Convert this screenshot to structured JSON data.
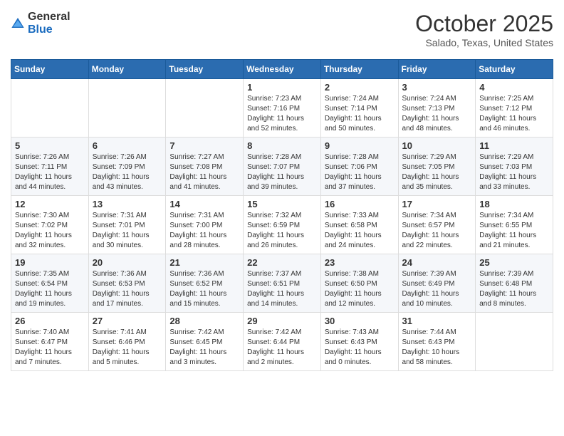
{
  "header": {
    "logo_general": "General",
    "logo_blue": "Blue",
    "month_title": "October 2025",
    "location": "Salado, Texas, United States"
  },
  "weekdays": [
    "Sunday",
    "Monday",
    "Tuesday",
    "Wednesday",
    "Thursday",
    "Friday",
    "Saturday"
  ],
  "weeks": [
    [
      {
        "day": "",
        "sunrise": "",
        "sunset": "",
        "daylight": ""
      },
      {
        "day": "",
        "sunrise": "",
        "sunset": "",
        "daylight": ""
      },
      {
        "day": "",
        "sunrise": "",
        "sunset": "",
        "daylight": ""
      },
      {
        "day": "1",
        "sunrise": "Sunrise: 7:23 AM",
        "sunset": "Sunset: 7:16 PM",
        "daylight": "Daylight: 11 hours and 52 minutes."
      },
      {
        "day": "2",
        "sunrise": "Sunrise: 7:24 AM",
        "sunset": "Sunset: 7:14 PM",
        "daylight": "Daylight: 11 hours and 50 minutes."
      },
      {
        "day": "3",
        "sunrise": "Sunrise: 7:24 AM",
        "sunset": "Sunset: 7:13 PM",
        "daylight": "Daylight: 11 hours and 48 minutes."
      },
      {
        "day": "4",
        "sunrise": "Sunrise: 7:25 AM",
        "sunset": "Sunset: 7:12 PM",
        "daylight": "Daylight: 11 hours and 46 minutes."
      }
    ],
    [
      {
        "day": "5",
        "sunrise": "Sunrise: 7:26 AM",
        "sunset": "Sunset: 7:11 PM",
        "daylight": "Daylight: 11 hours and 44 minutes."
      },
      {
        "day": "6",
        "sunrise": "Sunrise: 7:26 AM",
        "sunset": "Sunset: 7:09 PM",
        "daylight": "Daylight: 11 hours and 43 minutes."
      },
      {
        "day": "7",
        "sunrise": "Sunrise: 7:27 AM",
        "sunset": "Sunset: 7:08 PM",
        "daylight": "Daylight: 11 hours and 41 minutes."
      },
      {
        "day": "8",
        "sunrise": "Sunrise: 7:28 AM",
        "sunset": "Sunset: 7:07 PM",
        "daylight": "Daylight: 11 hours and 39 minutes."
      },
      {
        "day": "9",
        "sunrise": "Sunrise: 7:28 AM",
        "sunset": "Sunset: 7:06 PM",
        "daylight": "Daylight: 11 hours and 37 minutes."
      },
      {
        "day": "10",
        "sunrise": "Sunrise: 7:29 AM",
        "sunset": "Sunset: 7:05 PM",
        "daylight": "Daylight: 11 hours and 35 minutes."
      },
      {
        "day": "11",
        "sunrise": "Sunrise: 7:29 AM",
        "sunset": "Sunset: 7:03 PM",
        "daylight": "Daylight: 11 hours and 33 minutes."
      }
    ],
    [
      {
        "day": "12",
        "sunrise": "Sunrise: 7:30 AM",
        "sunset": "Sunset: 7:02 PM",
        "daylight": "Daylight: 11 hours and 32 minutes."
      },
      {
        "day": "13",
        "sunrise": "Sunrise: 7:31 AM",
        "sunset": "Sunset: 7:01 PM",
        "daylight": "Daylight: 11 hours and 30 minutes."
      },
      {
        "day": "14",
        "sunrise": "Sunrise: 7:31 AM",
        "sunset": "Sunset: 7:00 PM",
        "daylight": "Daylight: 11 hours and 28 minutes."
      },
      {
        "day": "15",
        "sunrise": "Sunrise: 7:32 AM",
        "sunset": "Sunset: 6:59 PM",
        "daylight": "Daylight: 11 hours and 26 minutes."
      },
      {
        "day": "16",
        "sunrise": "Sunrise: 7:33 AM",
        "sunset": "Sunset: 6:58 PM",
        "daylight": "Daylight: 11 hours and 24 minutes."
      },
      {
        "day": "17",
        "sunrise": "Sunrise: 7:34 AM",
        "sunset": "Sunset: 6:57 PM",
        "daylight": "Daylight: 11 hours and 22 minutes."
      },
      {
        "day": "18",
        "sunrise": "Sunrise: 7:34 AM",
        "sunset": "Sunset: 6:55 PM",
        "daylight": "Daylight: 11 hours and 21 minutes."
      }
    ],
    [
      {
        "day": "19",
        "sunrise": "Sunrise: 7:35 AM",
        "sunset": "Sunset: 6:54 PM",
        "daylight": "Daylight: 11 hours and 19 minutes."
      },
      {
        "day": "20",
        "sunrise": "Sunrise: 7:36 AM",
        "sunset": "Sunset: 6:53 PM",
        "daylight": "Daylight: 11 hours and 17 minutes."
      },
      {
        "day": "21",
        "sunrise": "Sunrise: 7:36 AM",
        "sunset": "Sunset: 6:52 PM",
        "daylight": "Daylight: 11 hours and 15 minutes."
      },
      {
        "day": "22",
        "sunrise": "Sunrise: 7:37 AM",
        "sunset": "Sunset: 6:51 PM",
        "daylight": "Daylight: 11 hours and 14 minutes."
      },
      {
        "day": "23",
        "sunrise": "Sunrise: 7:38 AM",
        "sunset": "Sunset: 6:50 PM",
        "daylight": "Daylight: 11 hours and 12 minutes."
      },
      {
        "day": "24",
        "sunrise": "Sunrise: 7:39 AM",
        "sunset": "Sunset: 6:49 PM",
        "daylight": "Daylight: 11 hours and 10 minutes."
      },
      {
        "day": "25",
        "sunrise": "Sunrise: 7:39 AM",
        "sunset": "Sunset: 6:48 PM",
        "daylight": "Daylight: 11 hours and 8 minutes."
      }
    ],
    [
      {
        "day": "26",
        "sunrise": "Sunrise: 7:40 AM",
        "sunset": "Sunset: 6:47 PM",
        "daylight": "Daylight: 11 hours and 7 minutes."
      },
      {
        "day": "27",
        "sunrise": "Sunrise: 7:41 AM",
        "sunset": "Sunset: 6:46 PM",
        "daylight": "Daylight: 11 hours and 5 minutes."
      },
      {
        "day": "28",
        "sunrise": "Sunrise: 7:42 AM",
        "sunset": "Sunset: 6:45 PM",
        "daylight": "Daylight: 11 hours and 3 minutes."
      },
      {
        "day": "29",
        "sunrise": "Sunrise: 7:42 AM",
        "sunset": "Sunset: 6:44 PM",
        "daylight": "Daylight: 11 hours and 2 minutes."
      },
      {
        "day": "30",
        "sunrise": "Sunrise: 7:43 AM",
        "sunset": "Sunset: 6:43 PM",
        "daylight": "Daylight: 11 hours and 0 minutes."
      },
      {
        "day": "31",
        "sunrise": "Sunrise: 7:44 AM",
        "sunset": "Sunset: 6:43 PM",
        "daylight": "Daylight: 10 hours and 58 minutes."
      },
      {
        "day": "",
        "sunrise": "",
        "sunset": "",
        "daylight": ""
      }
    ]
  ]
}
